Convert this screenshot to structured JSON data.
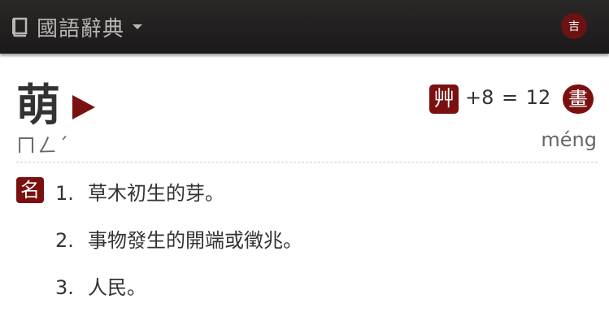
{
  "header": {
    "title": "國語辭典",
    "book_icon": "book-icon",
    "menu_icon": "seal-icon",
    "menu_glyph": "吉"
  },
  "entry": {
    "character": "萌",
    "bopomofo": "ㄇㄥˊ",
    "pinyin": "méng",
    "radical": "艸",
    "stroke_text": "+8 = 12",
    "stroke_badge": "畫"
  },
  "definitions": {
    "part_of_speech": "名",
    "items": [
      {
        "num": "1.",
        "text": "草木初生的芽。"
      },
      {
        "num": "2.",
        "text": "事物發生的開端或徵兆。"
      },
      {
        "num": "3.",
        "text": "人民。"
      }
    ]
  },
  "colors": {
    "accent": "#7a1010",
    "topbar": "#221f1f",
    "topbar_text": "#b9b6b3"
  }
}
